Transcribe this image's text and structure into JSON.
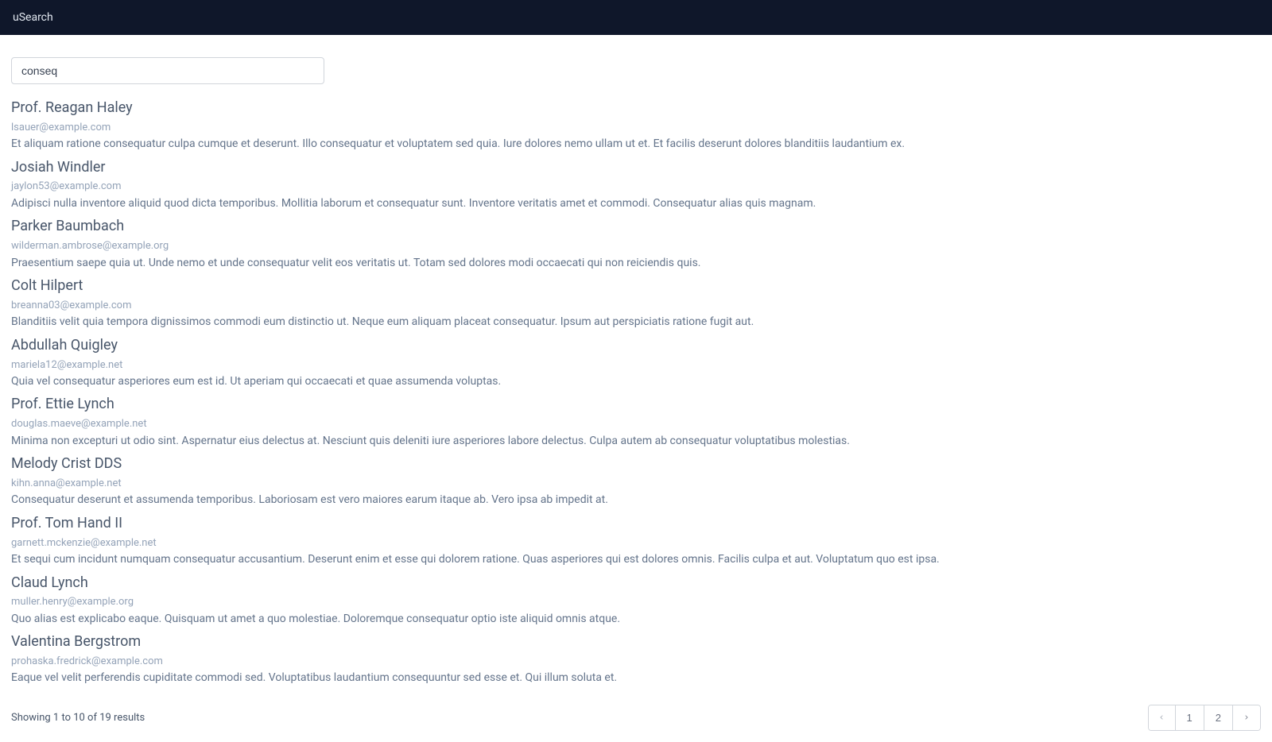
{
  "navbar": {
    "brand": "uSearch"
  },
  "search": {
    "value": "conseq"
  },
  "results": [
    {
      "name": "Prof. Reagan Haley",
      "email": "lsauer@example.com",
      "description": "Et aliquam ratione consequatur culpa cumque et deserunt. Illo consequatur et voluptatem sed quia. Iure dolores nemo ullam ut et. Et facilis deserunt dolores blanditiis laudantium ex."
    },
    {
      "name": "Josiah Windler",
      "email": "jaylon53@example.com",
      "description": "Adipisci nulla inventore aliquid quod dicta temporibus. Mollitia laborum et consequatur sunt. Inventore veritatis amet et commodi. Consequatur alias quis magnam."
    },
    {
      "name": "Parker Baumbach",
      "email": "wilderman.ambrose@example.org",
      "description": "Praesentium saepe quia ut. Unde nemo et unde consequatur velit eos veritatis ut. Totam sed dolores modi occaecati qui non reiciendis quis."
    },
    {
      "name": "Colt Hilpert",
      "email": "breanna03@example.com",
      "description": "Blanditiis velit quia tempora dignissimos commodi eum distinctio ut. Neque eum aliquam placeat consequatur. Ipsum aut perspiciatis ratione fugit aut."
    },
    {
      "name": "Abdullah Quigley",
      "email": "mariela12@example.net",
      "description": "Quia vel consequatur asperiores eum est id. Ut aperiam qui occaecati et quae assumenda voluptas."
    },
    {
      "name": "Prof. Ettie Lynch",
      "email": "douglas.maeve@example.net",
      "description": "Minima non excepturi ut odio sint. Aspernatur eius delectus at. Nesciunt quis deleniti iure asperiores labore delectus. Culpa autem ab consequatur voluptatibus molestias."
    },
    {
      "name": "Melody Crist DDS",
      "email": "kihn.anna@example.net",
      "description": "Consequatur deserunt et assumenda temporibus. Laboriosam est vero maiores earum itaque ab. Vero ipsa ab impedit at."
    },
    {
      "name": "Prof. Tom Hand II",
      "email": "garnett.mckenzie@example.net",
      "description": "Et sequi cum incidunt numquam consequatur accusantium. Deserunt enim et esse qui dolorem ratione. Quas asperiores qui est dolores omnis. Facilis culpa et aut. Voluptatum quo est ipsa."
    },
    {
      "name": "Claud Lynch",
      "email": "muller.henry@example.org",
      "description": "Quo alias est explicabo eaque. Quisquam ut amet a quo molestiae. Doloremque consequatur optio iste aliquid omnis atque."
    },
    {
      "name": "Valentina Bergstrom",
      "email": "prohaska.fredrick@example.com",
      "description": "Eaque vel velit perferendis cupiditate commodi sed. Voluptatibus laudantium consequuntur sed esse et. Qui illum soluta et."
    }
  ],
  "pagination": {
    "info": "Showing 1 to 10 of 19 results",
    "pages": [
      "1",
      "2"
    ],
    "current": 1
  }
}
